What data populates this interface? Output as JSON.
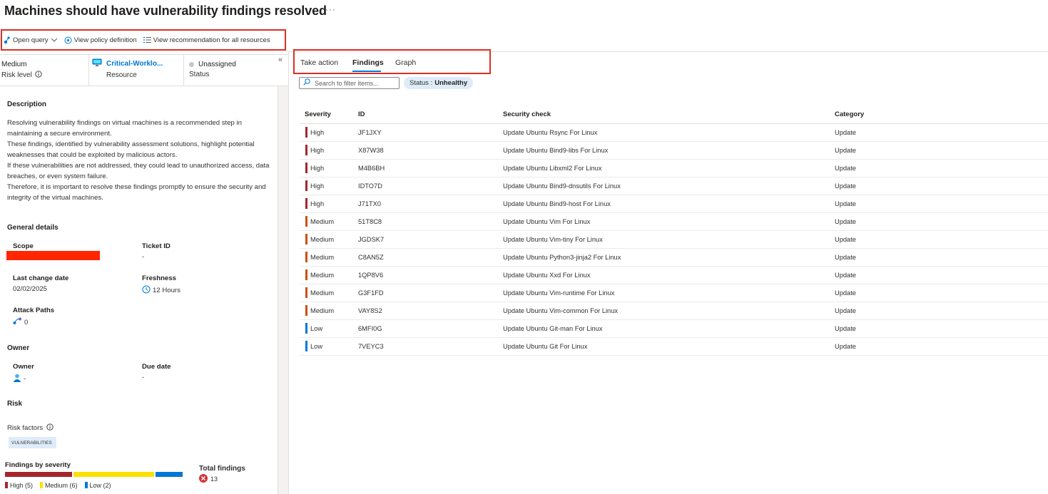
{
  "header": {
    "title": "Machines should have vulnerability findings resolved",
    "more": "···"
  },
  "toolbar": {
    "open_query": "Open query",
    "view_policy": "View policy definition",
    "view_recommendation": "View recommendation for all resources"
  },
  "summary": {
    "risk_value": "Medium",
    "risk_label": "Risk level",
    "resource_value": "Critical-Worklo...",
    "resource_label": "Resource",
    "status_value": "Unassigned",
    "status_label": "Status"
  },
  "description": {
    "heading": "Description",
    "text": "Resolving vulnerability findings on virtual machines is a recommended step in maintaining a secure environment.\nThese findings, identified by vulnerability assessment solutions, highlight potential weaknesses that could be exploited by malicious actors.\nIf these vulnerabilities are not addressed, they could lead to unauthorized access, data breaches, or even system failure.\nTherefore, it is important to resolve these findings promptly to ensure the security and integrity of the virtual machines."
  },
  "general": {
    "heading": "General details",
    "scope_label": "Scope",
    "ticket_label": "Ticket ID",
    "ticket_value": "-",
    "last_change_label": "Last change date",
    "last_change_value": "02/02/2025",
    "freshness_label": "Freshness",
    "freshness_value": "12 Hours",
    "attack_label": "Attack Paths",
    "attack_value": "0"
  },
  "owner": {
    "heading": "Owner",
    "owner_label": "Owner",
    "owner_value": "-",
    "due_label": "Due date",
    "due_value": "-"
  },
  "risk": {
    "heading": "Risk",
    "factors_label": "Risk factors",
    "tag": "VULNERABILITIES"
  },
  "severity": {
    "title": "Findings by severity",
    "high": {
      "label": "High (5)",
      "count": 5,
      "color": "#a4262c"
    },
    "medium": {
      "label": "Medium (6)",
      "count": 6,
      "color": "#fce100"
    },
    "low": {
      "label": "Low (2)",
      "count": 2,
      "color": "#0078d4"
    },
    "total_label": "Total findings",
    "total_value": "13"
  },
  "tabs": {
    "take_action": "Take action",
    "findings": "Findings",
    "graph": "Graph",
    "active": "findings"
  },
  "filter": {
    "placeholder": "Search to filter items...",
    "pill_key": "Status :",
    "pill_value": "Unhealthy"
  },
  "table": {
    "columns": [
      "Severity",
      "ID",
      "Security check",
      "Category"
    ],
    "rows": [
      {
        "severity": "High",
        "id": "JF1JXY",
        "check": "Update Ubuntu Rsync For Linux",
        "category": "Update"
      },
      {
        "severity": "High",
        "id": "X87W38",
        "check": "Update Ubuntu Bind9-libs For Linux",
        "category": "Update"
      },
      {
        "severity": "High",
        "id": "M4B6BH",
        "check": "Update Ubuntu Libxml2 For Linux",
        "category": "Update"
      },
      {
        "severity": "High",
        "id": "IDTO7D",
        "check": "Update Ubuntu Bind9-dnsutils For Linux",
        "category": "Update"
      },
      {
        "severity": "High",
        "id": "J71TX0",
        "check": "Update Ubuntu Bind9-host For Linux",
        "category": "Update"
      },
      {
        "severity": "Medium",
        "id": "51T8C8",
        "check": "Update Ubuntu Vim For Linux",
        "category": "Update"
      },
      {
        "severity": "Medium",
        "id": "JGDSK7",
        "check": "Update Ubuntu Vim-tiny For Linux",
        "category": "Update"
      },
      {
        "severity": "Medium",
        "id": "C8AN5Z",
        "check": "Update Ubuntu Python3-jinja2 For Linux",
        "category": "Update"
      },
      {
        "severity": "Medium",
        "id": "1QP8V6",
        "check": "Update Ubuntu Xxd For Linux",
        "category": "Update"
      },
      {
        "severity": "Medium",
        "id": "G3F1FD",
        "check": "Update Ubuntu Vim-runtime For Linux",
        "category": "Update"
      },
      {
        "severity": "Medium",
        "id": "VAY8S2",
        "check": "Update Ubuntu Vim-common For Linux",
        "category": "Update"
      },
      {
        "severity": "Low",
        "id": "6MFI0G",
        "check": "Update Ubuntu Git-man For Linux",
        "category": "Update"
      },
      {
        "severity": "Low",
        "id": "7VEYC3",
        "check": "Update Ubuntu Git For Linux",
        "category": "Update"
      }
    ]
  },
  "colors": {
    "high": "#a4262c",
    "medium": "#ca5010",
    "low": "#0078d4",
    "accent": "#0078d4"
  }
}
